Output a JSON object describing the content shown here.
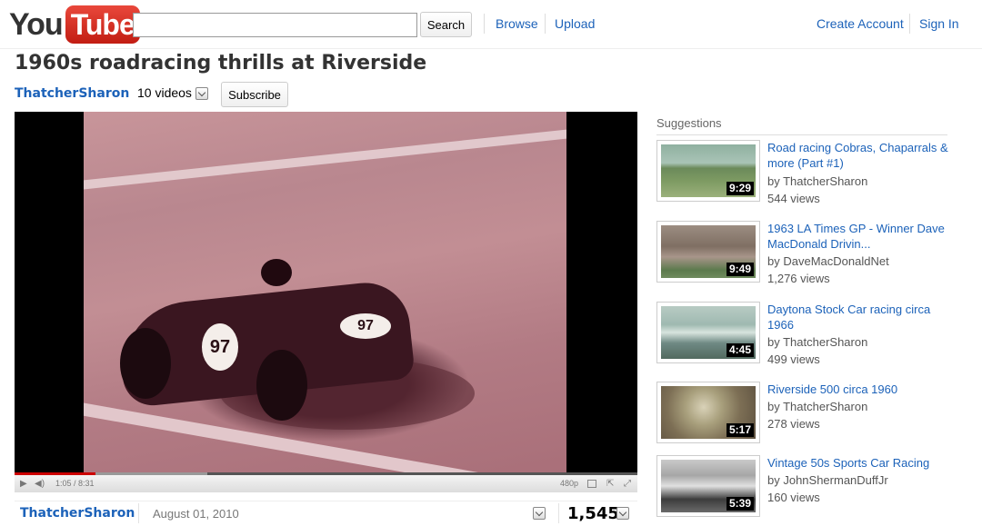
{
  "header": {
    "logo_text_1": "You",
    "logo_text_2": "Tube",
    "search_value": "",
    "search_button": "Search",
    "nav": [
      "Browse",
      "Upload"
    ],
    "account": [
      "Create Account",
      "Sign In"
    ]
  },
  "video": {
    "title": "1960s roadracing thrills at Riverside",
    "owner": "ThatcherSharon",
    "videos_count": "10 videos",
    "subscribe_label": "Subscribe",
    "car_number": "97",
    "time_display": "1:05 / 8:31",
    "quality": "480p",
    "progress_fraction": 0.13,
    "loaded_fraction": 0.31,
    "uploader": "ThatcherSharon",
    "upload_date": "August 01, 2010",
    "view_count": "1,545"
  },
  "suggestions": {
    "header": "Suggestions",
    "items": [
      {
        "title": "Road racing Cobras, Chaparrals & more (Part #1)",
        "by": "by ThatcherSharon",
        "views": "544 views",
        "duration": "9:29"
      },
      {
        "title": "1963 LA Times GP - Winner Dave MacDonald Drivin...",
        "by": "by DaveMacDonaldNet",
        "views": "1,276 views",
        "duration": "9:49"
      },
      {
        "title": "Daytona Stock Car racing circa 1966",
        "by": "by ThatcherSharon",
        "views": "499 views",
        "duration": "4:45"
      },
      {
        "title": "Riverside 500 circa 1960",
        "by": "by ThatcherSharon",
        "views": "278 views",
        "duration": "5:17"
      },
      {
        "title": "Vintage 50s Sports Car Racing",
        "by": "by JohnShermanDuffJr",
        "views": "160 views",
        "duration": "5:39"
      }
    ]
  },
  "colors": {
    "link": "#1c62b9",
    "logo_red": "#d7261c",
    "progress_played": "#cc0000"
  }
}
